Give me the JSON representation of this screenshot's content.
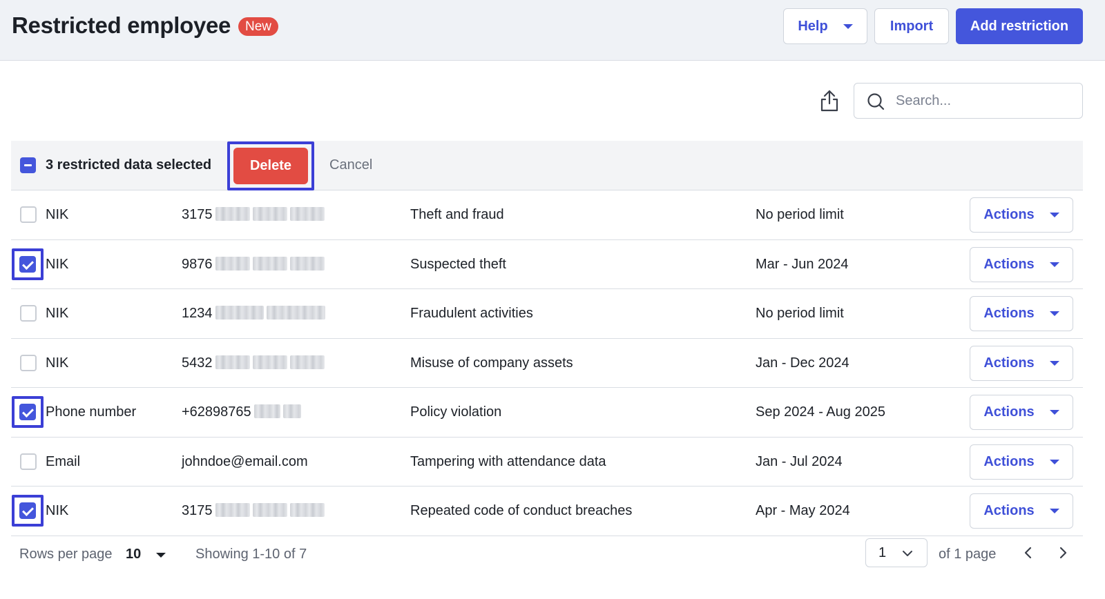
{
  "header": {
    "title": "Restricted employee",
    "badge": "New",
    "help_label": "Help",
    "import_label": "Import",
    "add_label": "Add restriction"
  },
  "toolbar": {
    "search_placeholder": "Search..."
  },
  "selection": {
    "text": "3 restricted data selected",
    "delete_label": "Delete",
    "cancel_label": "Cancel"
  },
  "rows": [
    {
      "type": "NIK",
      "value": "3175",
      "reason": "Theft and fraud",
      "period": "No period limit",
      "checked": false,
      "action": "Actions"
    },
    {
      "type": "NIK",
      "value": "9876",
      "reason": "Suspected theft",
      "period": "Mar - Jun 2024",
      "checked": true,
      "action": "Actions"
    },
    {
      "type": "NIK",
      "value": "1234",
      "reason": "Fraudulent activities",
      "period": "No period limit",
      "checked": false,
      "action": "Actions"
    },
    {
      "type": "NIK",
      "value": "5432",
      "reason": "Misuse of company assets",
      "period": "Jan - Dec 2024",
      "checked": false,
      "action": "Actions"
    },
    {
      "type": "Phone number",
      "value": "+62898765",
      "reason": "Policy violation",
      "period": "Sep 2024 - Aug 2025",
      "checked": true,
      "action": "Actions"
    },
    {
      "type": "Email",
      "value": "johndoe@email.com",
      "reason": "Tampering with attendance data",
      "period": "Jan - Jul 2024",
      "checked": false,
      "action": "Actions"
    },
    {
      "type": "NIK",
      "value": "3175",
      "reason": "Repeated code of conduct breaches",
      "period": "Apr - May 2024",
      "checked": true,
      "action": "Actions"
    }
  ],
  "footer": {
    "rows_per_page_label": "Rows per page",
    "rows_per_page_value": "10",
    "showing": "Showing 1-10 of 7",
    "page_value": "1",
    "of_pages": "of 1 page"
  },
  "colors": {
    "primary": "#4456dc",
    "danger": "#e24c43",
    "highlight_frame": "#3b3fd6"
  }
}
